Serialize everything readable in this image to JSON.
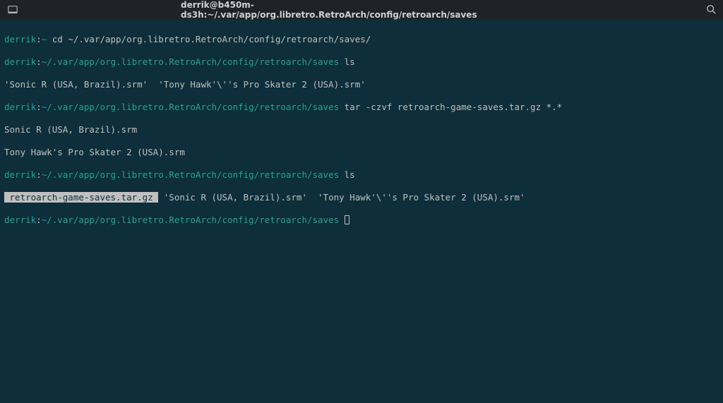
{
  "titlebar": {
    "title": "derrik@b450m-ds3h:~/.var/app/org.libretro.RetroArch/config/retroarch/saves"
  },
  "prompt": {
    "user": "derrik",
    "path_short": "~",
    "path_long": "~/.var/app/org.libretro.RetroArch/config/retroarch/saves"
  },
  "lines": {
    "l1_cmd": " cd ~/.var/app/org.libretro.RetroArch/config/retroarch/saves/",
    "l2_cmd": " ls",
    "l3_out": "'Sonic R (USA, Brazil).srm'  'Tony Hawk'\\''s Pro Skater 2 (USA).srm'",
    "l4_cmd": " tar -czvf retroarch-game-saves.tar.gz *.*",
    "l5_out": "Sonic R (USA, Brazil).srm",
    "l6_out": "Tony Hawk's Pro Skater 2 (USA).srm",
    "l7_cmd": " ls",
    "l8_hl": " retroarch-game-saves.tar.gz ",
    "l8_rest": " 'Sonic R (USA, Brazil).srm'  'Tony Hawk'\\''s Pro Skater 2 (USA).srm'",
    "l9_cmd": " "
  },
  "sep": ":"
}
